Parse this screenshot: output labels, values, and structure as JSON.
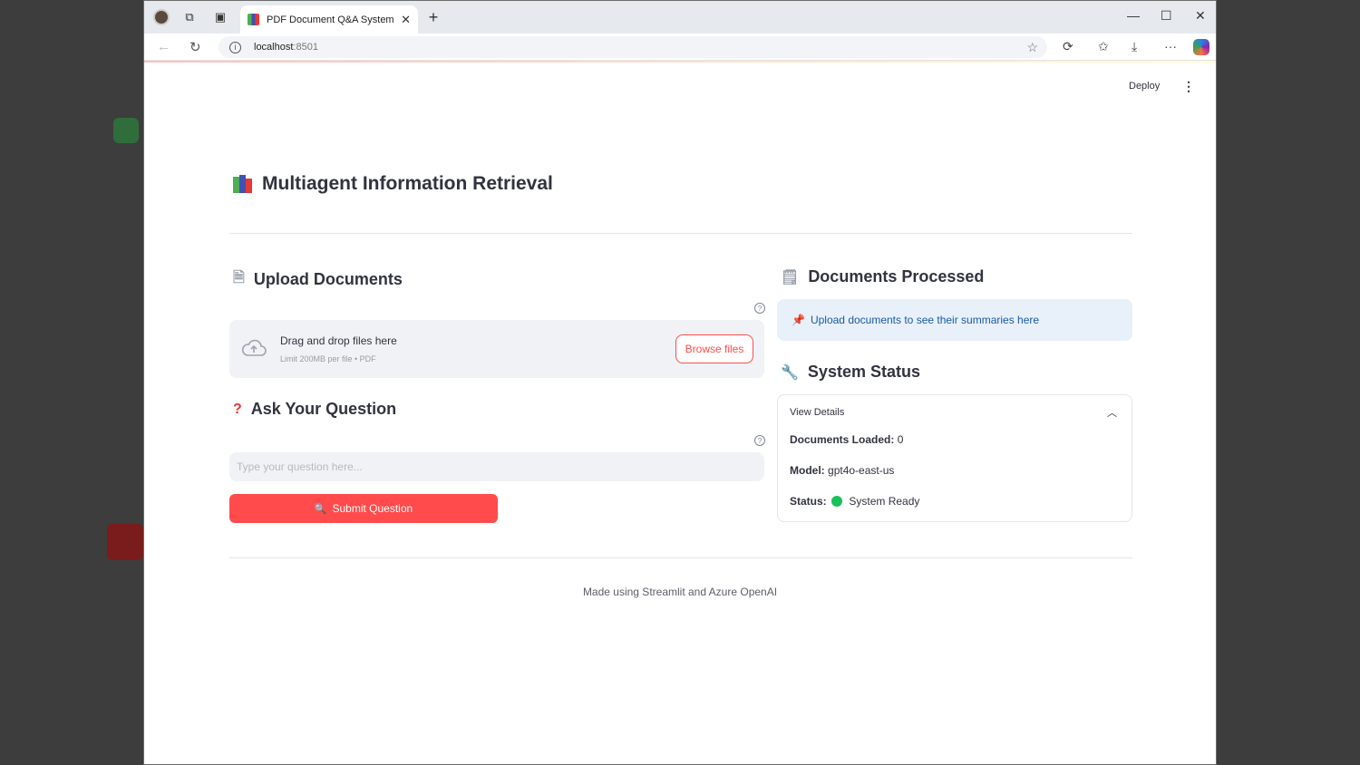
{
  "browser": {
    "tab_title": "PDF Document Q&A System",
    "url_host": "localhost",
    "url_port": ":8501"
  },
  "header": {
    "deploy_label": "Deploy"
  },
  "app": {
    "title": "Multiagent Information Retrieval"
  },
  "upload": {
    "heading": "Upload Documents",
    "drop_text": "Drag and drop files here",
    "limit_text": "Limit 200MB per file • PDF",
    "browse_label": "Browse files"
  },
  "question": {
    "heading": "Ask Your Question",
    "placeholder": "Type your question here...",
    "submit_label": "Submit Question"
  },
  "processed": {
    "heading": "Documents Processed",
    "info_text": "Upload documents to see their summaries here"
  },
  "status": {
    "heading": "System Status",
    "expander_label": "View Details",
    "docs_label": "Documents Loaded:",
    "docs_value": "0",
    "model_label": "Model:",
    "model_value": "gpt4o-east-us",
    "status_label": "Status:",
    "status_value": "System Ready"
  },
  "footer": {
    "text": "Made using Streamlit and Azure OpenAI"
  },
  "colors": {
    "primary": "#ff4b4b",
    "info_bg": "#e8f0f9",
    "ready": "#19c15a"
  }
}
